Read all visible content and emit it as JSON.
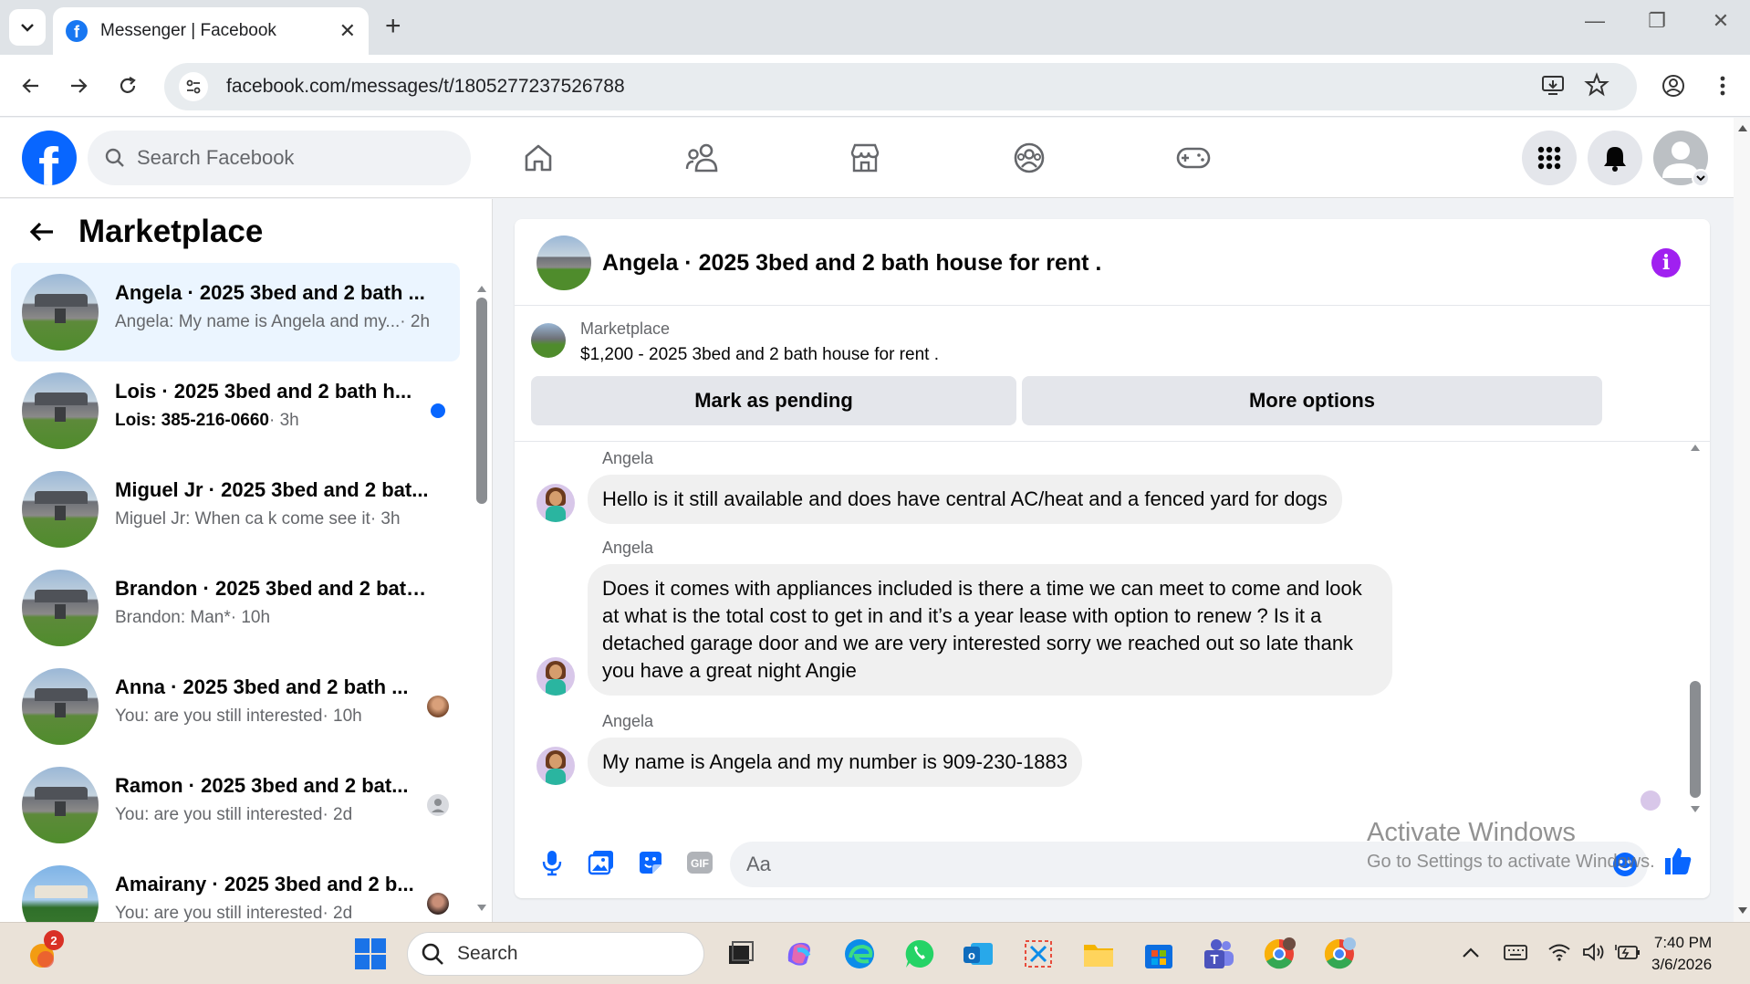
{
  "browser": {
    "tab_title": "Messenger | Facebook",
    "url": "facebook.com/messages/t/1805277237526788",
    "new_tab": "+",
    "minimize": "—",
    "restore": "❐",
    "close": "✕"
  },
  "fb_header": {
    "logo": "f",
    "search_placeholder": "Search Facebook"
  },
  "sidebar": {
    "title": "Marketplace",
    "conversations": [
      {
        "name": "Angela · 2025 3bed and 2 bath ...",
        "snippet": "Angela: My name is Angela and my...",
        "time": "· 2h",
        "active": true
      },
      {
        "name": "Lois · 2025 3bed and 2 bath h...",
        "snippet": "Lois: 385-216-0660",
        "time": "· 3h",
        "unread": true
      },
      {
        "name": "Miguel Jr · 2025 3bed and 2 bat...",
        "snippet": "Miguel Jr: When ca k come see it",
        "time": "· 3h"
      },
      {
        "name": "Brandon · 2025 3bed and 2 bath...",
        "snippet": "Brandon: Man*",
        "time": "· 10h"
      },
      {
        "name": "Anna · 2025 3bed and 2 bath ...",
        "snippet": "You: are you still interested",
        "time": "· 10h"
      },
      {
        "name": "Ramon · 2025 3bed and 2 bat...",
        "snippet": "You: are you still interested",
        "time": "· 2d"
      },
      {
        "name": "Amairany · 2025 3bed and 2 b...",
        "snippet": "You: are you still interested",
        "time": "· 2d"
      }
    ]
  },
  "chat": {
    "title": "Angela · 2025 3bed and 2 bath house for rent .",
    "listing_tag": "Marketplace",
    "listing_price": "$1,200 - 2025 3bed and 2 bath house for rent .",
    "mark_pending": "Mark as pending",
    "more_options": "More options",
    "messages": [
      {
        "sender": "Angela",
        "text": "Hello is it still available and does have central AC/heat and a fenced yard for dogs"
      },
      {
        "sender": "Angela",
        "text": "Does it comes with appliances included is there a time we can meet to come and look at what is the total cost to get in and it’s a year lease with option to renew ? Is it a detached garage door and we are very interested sorry we reached out so late thank you have a great night Angie"
      },
      {
        "sender": "Angela",
        "text": "My name is Angela and my number is 909-230-1883"
      }
    ],
    "composer_placeholder": "Aa"
  },
  "watermark": {
    "line1": "Activate Windows",
    "line2": "Go to Settings to activate Windows."
  },
  "taskbar": {
    "search": "Search",
    "time": "7:40 PM",
    "date": "3/6/2026",
    "notif_count": "2"
  },
  "colors": {
    "fb_blue": "#0866ff",
    "active_row": "#ebf5ff",
    "info_purple": "#a020f0"
  }
}
